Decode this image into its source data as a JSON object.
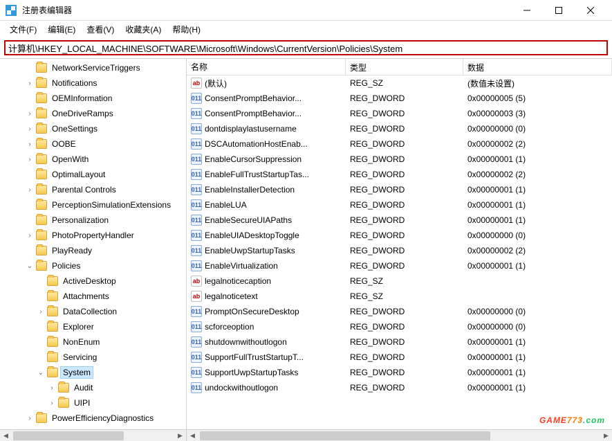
{
  "window": {
    "title": "注册表编辑器"
  },
  "menu": {
    "file": "文件(F)",
    "edit": "编辑(E)",
    "view": "查看(V)",
    "favorites": "收藏夹(A)",
    "help": "帮助(H)"
  },
  "address": "计算机\\HKEY_LOCAL_MACHINE\\SOFTWARE\\Microsoft\\Windows\\CurrentVersion\\Policies\\System",
  "columns": {
    "name": "名称",
    "type": "类型",
    "data": "数据"
  },
  "tree": [
    {
      "indent": 2,
      "exp": "",
      "label": "NetworkServiceTriggers"
    },
    {
      "indent": 2,
      "exp": "closed",
      "label": "Notifications"
    },
    {
      "indent": 2,
      "exp": "",
      "label": "OEMInformation"
    },
    {
      "indent": 2,
      "exp": "closed",
      "label": "OneDriveRamps"
    },
    {
      "indent": 2,
      "exp": "closed",
      "label": "OneSettings"
    },
    {
      "indent": 2,
      "exp": "closed",
      "label": "OOBE"
    },
    {
      "indent": 2,
      "exp": "closed",
      "label": "OpenWith"
    },
    {
      "indent": 2,
      "exp": "",
      "label": "OptimalLayout"
    },
    {
      "indent": 2,
      "exp": "closed",
      "label": "Parental Controls"
    },
    {
      "indent": 2,
      "exp": "",
      "label": "PerceptionSimulationExtensions"
    },
    {
      "indent": 2,
      "exp": "",
      "label": "Personalization"
    },
    {
      "indent": 2,
      "exp": "closed",
      "label": "PhotoPropertyHandler"
    },
    {
      "indent": 2,
      "exp": "",
      "label": "PlayReady"
    },
    {
      "indent": 2,
      "exp": "open",
      "label": "Policies"
    },
    {
      "indent": 3,
      "exp": "",
      "label": "ActiveDesktop"
    },
    {
      "indent": 3,
      "exp": "",
      "label": "Attachments"
    },
    {
      "indent": 3,
      "exp": "closed",
      "label": "DataCollection"
    },
    {
      "indent": 3,
      "exp": "",
      "label": "Explorer"
    },
    {
      "indent": 3,
      "exp": "",
      "label": "NonEnum"
    },
    {
      "indent": 3,
      "exp": "",
      "label": "Servicing"
    },
    {
      "indent": 3,
      "exp": "open",
      "label": "System",
      "selected": true
    },
    {
      "indent": 4,
      "exp": "closed",
      "label": "Audit"
    },
    {
      "indent": 4,
      "exp": "closed",
      "label": "UIPI"
    },
    {
      "indent": 2,
      "exp": "closed",
      "label": "PowerEfficiencyDiagnostics"
    }
  ],
  "values": [
    {
      "icon": "sz",
      "name": "(默认)",
      "type": "REG_SZ",
      "data": "(数值未设置)"
    },
    {
      "icon": "dw",
      "name": "ConsentPromptBehavior...",
      "type": "REG_DWORD",
      "data": "0x00000005 (5)"
    },
    {
      "icon": "dw",
      "name": "ConsentPromptBehavior...",
      "type": "REG_DWORD",
      "data": "0x00000003 (3)"
    },
    {
      "icon": "dw",
      "name": "dontdisplaylastusername",
      "type": "REG_DWORD",
      "data": "0x00000000 (0)"
    },
    {
      "icon": "dw",
      "name": "DSCAutomationHostEnab...",
      "type": "REG_DWORD",
      "data": "0x00000002 (2)"
    },
    {
      "icon": "dw",
      "name": "EnableCursorSuppression",
      "type": "REG_DWORD",
      "data": "0x00000001 (1)"
    },
    {
      "icon": "dw",
      "name": "EnableFullTrustStartupTas...",
      "type": "REG_DWORD",
      "data": "0x00000002 (2)"
    },
    {
      "icon": "dw",
      "name": "EnableInstallerDetection",
      "type": "REG_DWORD",
      "data": "0x00000001 (1)"
    },
    {
      "icon": "dw",
      "name": "EnableLUA",
      "type": "REG_DWORD",
      "data": "0x00000001 (1)"
    },
    {
      "icon": "dw",
      "name": "EnableSecureUIAPaths",
      "type": "REG_DWORD",
      "data": "0x00000001 (1)"
    },
    {
      "icon": "dw",
      "name": "EnableUIADesktopToggle",
      "type": "REG_DWORD",
      "data": "0x00000000 (0)"
    },
    {
      "icon": "dw",
      "name": "EnableUwpStartupTasks",
      "type": "REG_DWORD",
      "data": "0x00000002 (2)"
    },
    {
      "icon": "dw",
      "name": "EnableVirtualization",
      "type": "REG_DWORD",
      "data": "0x00000001 (1)"
    },
    {
      "icon": "sz",
      "name": "legalnoticecaption",
      "type": "REG_SZ",
      "data": ""
    },
    {
      "icon": "sz",
      "name": "legalnoticetext",
      "type": "REG_SZ",
      "data": ""
    },
    {
      "icon": "dw",
      "name": "PromptOnSecureDesktop",
      "type": "REG_DWORD",
      "data": "0x00000000 (0)"
    },
    {
      "icon": "dw",
      "name": "scforceoption",
      "type": "REG_DWORD",
      "data": "0x00000000 (0)"
    },
    {
      "icon": "dw",
      "name": "shutdownwithoutlogon",
      "type": "REG_DWORD",
      "data": "0x00000001 (1)"
    },
    {
      "icon": "dw",
      "name": "SupportFullTrustStartupT...",
      "type": "REG_DWORD",
      "data": "0x00000001 (1)"
    },
    {
      "icon": "dw",
      "name": "SupportUwpStartupTasks",
      "type": "REG_DWORD",
      "data": "0x00000001 (1)"
    },
    {
      "icon": "dw",
      "name": "undockwithoutlogon",
      "type": "REG_DWORD",
      "data": "0x00000001 (1)"
    }
  ],
  "watermark": "GAME773.com"
}
